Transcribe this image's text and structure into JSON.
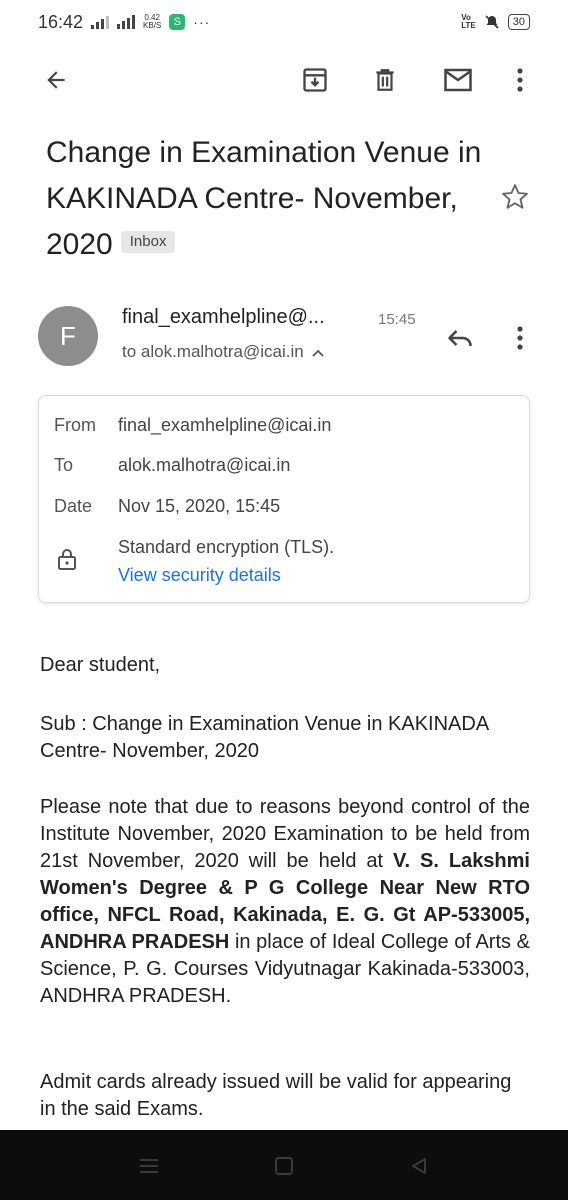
{
  "status": {
    "time": "16:42",
    "speed_value": "0.42",
    "speed_unit": "KB/S",
    "app_glyph": "S",
    "dots": "···",
    "volte": "Vo\nLTE",
    "battery": "30"
  },
  "toolbar": {
    "icons": [
      "back-arrow-icon",
      "archive-icon",
      "delete-icon",
      "mail-icon",
      "more-vert-icon"
    ]
  },
  "email": {
    "subject": "Change in Examination Venue in KAKINADA Centre- November, 2020",
    "label": "Inbox",
    "sender_initial": "F",
    "sender_display": "final_examhelpline@...",
    "time": "15:45",
    "to_line": "to alok.malhotra@icai.in",
    "details": {
      "from_label": "From",
      "from_value": "final_examhelpline@icai.in",
      "to_label": "To",
      "to_value": "alok.malhotra@icai.in",
      "date_label": "Date",
      "date_value": "Nov 15, 2020, 15:45",
      "encryption": "Standard encryption (TLS).",
      "security_link": "View security details"
    },
    "body": {
      "greeting": "Dear student,",
      "sub": "Sub : Change in Examination Venue in KAKINADA Centre- November, 2020",
      "p1_a": "Please note that due to reasons beyond control of the Institute November, 2020 Examination to be held from 21st November, 2020 will be held at ",
      "p1_bold": "V. S. Lakshmi Women's Degree & P G College Near New RTO office, NFCL Road, Kakinada, E. G. Gt AP-533005, ANDHRA PRADESH",
      "p1_b": " in place of Ideal College of Arts & Science, P. G. Courses Vidyutnagar Kakinada-533003, ANDHRA PRADESH.",
      "p2": "Admit cards already issued will be valid for appearing in the said Exams."
    }
  },
  "colors": {
    "link": "#1a73e8",
    "avatar": "#8d8d8d",
    "navbar": "#0d0d0d"
  }
}
